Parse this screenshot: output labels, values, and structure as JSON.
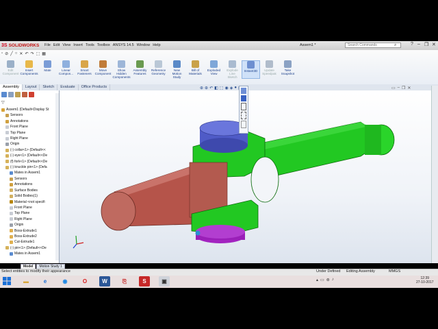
{
  "app": {
    "brand": "SOLIDWORKS",
    "menus": [
      "File",
      "Edit",
      "View",
      "Insert",
      "Tools",
      "Toolbox",
      "ANSYS 14.5",
      "Window",
      "Help"
    ],
    "document_title": "Assem1 *",
    "search_placeholder": "Search Commands"
  },
  "command_manager": [
    {
      "label": "Edit\nComponent",
      "icon": "edit-component-icon",
      "color": "#9bb0c8",
      "disabled": true
    },
    {
      "label": "Insert\nComponents",
      "icon": "insert-components-icon",
      "color": "#e8b84a"
    },
    {
      "label": "Mate",
      "icon": "mate-icon",
      "color": "#7a9cd6"
    },
    {
      "label": "Linear\nCompon...",
      "icon": "linear-pattern-icon",
      "color": "#8fb0de"
    },
    {
      "label": "Smart\nFasteners",
      "icon": "smart-fasteners-icon",
      "color": "#d9a64a"
    },
    {
      "label": "Move\nComponent",
      "icon": "move-component-icon",
      "color": "#c07c3a"
    },
    {
      "label": "Show\nHidden\nComponents",
      "icon": "show-hidden-icon",
      "color": "#9db6d8"
    },
    {
      "label": "Assembly\nFeatures",
      "icon": "assembly-features-icon",
      "color": "#6a9a50"
    },
    {
      "label": "Reference\nGeometry",
      "icon": "reference-geometry-icon",
      "color": "#b9c7d6"
    },
    {
      "label": "New\nMotion\nStudy",
      "icon": "motion-study-icon",
      "color": "#5b8ac8"
    },
    {
      "label": "Bill of\nMaterials",
      "icon": "bill-of-materials-icon",
      "color": "#c9a24a"
    },
    {
      "label": "Exploded\nView",
      "icon": "exploded-view-icon",
      "color": "#7fa7d8"
    },
    {
      "label": "Explode\nLine\nSketch",
      "icon": "explode-line-icon",
      "color": "#aabbd0",
      "disabled": true
    },
    {
      "label": "Instant3D",
      "icon": "instant3d-icon",
      "color": "#6d8fd0",
      "active": true
    },
    {
      "label": "Update\nSpeedpak",
      "icon": "speedpak-icon",
      "color": "#b0bccb",
      "disabled": true
    },
    {
      "label": "Take\nSnapshot",
      "icon": "snapshot-icon",
      "color": "#8ba2c4"
    }
  ],
  "tabs": [
    "Assembly",
    "Layout",
    "Sketch",
    "Evaluate",
    "Office Products"
  ],
  "selected_tab": "Assembly",
  "feature_tree": [
    {
      "label": "Assem1  (Default<Display St",
      "icon": "assembly-icon",
      "color": "#d6a23a",
      "indent": 0
    },
    {
      "label": "Sensors",
      "icon": "sensors-icon",
      "color": "#c8a050",
      "indent": 1
    },
    {
      "label": "Annotations",
      "icon": "annotations-icon",
      "color": "#d0a040",
      "indent": 1
    },
    {
      "label": "Front Plane",
      "icon": "plane-icon",
      "color": "#c8ccd4",
      "indent": 1
    },
    {
      "label": "Top Plane",
      "icon": "plane-icon",
      "color": "#c8ccd4",
      "indent": 1
    },
    {
      "label": "Right Plane",
      "icon": "plane-icon",
      "color": "#c8ccd4",
      "indent": 1
    },
    {
      "label": "Origin",
      "icon": "origin-icon",
      "color": "#9aa0aa",
      "indent": 1
    },
    {
      "label": "(-) collar<1> (Default<<",
      "icon": "part-icon",
      "color": "#d6b25a",
      "indent": 1
    },
    {
      "label": "(-) eye<1> (Default<<De",
      "icon": "part-icon",
      "color": "#d6b25a",
      "indent": 1
    },
    {
      "label": "(f) fork<1> (Default<<De",
      "icon": "part-icon",
      "color": "#d6b25a",
      "indent": 1
    },
    {
      "label": "(-) knuckle pin<1> (Defa",
      "icon": "part-icon",
      "color": "#d6b25a",
      "indent": 1
    },
    {
      "label": "Mates in Assem1",
      "icon": "mates-icon",
      "color": "#5a8bd0",
      "indent": 2
    },
    {
      "label": "Sensors",
      "icon": "sensors-icon",
      "color": "#c8a050",
      "indent": 2
    },
    {
      "label": "Annotations",
      "icon": "annotations-icon",
      "color": "#d0a040",
      "indent": 2
    },
    {
      "label": "Surface Bodies",
      "icon": "surface-bodies-icon",
      "color": "#d2b060",
      "indent": 2
    },
    {
      "label": "Solid Bodies(1)",
      "icon": "solid-bodies-icon",
      "color": "#d2b060",
      "indent": 2
    },
    {
      "label": "Material <not specifi",
      "icon": "material-icon",
      "color": "#b8860b",
      "indent": 2
    },
    {
      "label": "Front Plane",
      "icon": "plane-icon",
      "color": "#c8ccd4",
      "indent": 2
    },
    {
      "label": "Top Plane",
      "icon": "plane-icon",
      "color": "#c8ccd4",
      "indent": 2
    },
    {
      "label": "Right Plane",
      "icon": "plane-icon",
      "color": "#c8ccd4",
      "indent": 2
    },
    {
      "label": "Origin",
      "icon": "origin-icon",
      "color": "#9aa0aa",
      "indent": 2
    },
    {
      "label": "Boss-Extrude1",
      "icon": "extrude-icon",
      "color": "#e0b050",
      "indent": 2
    },
    {
      "label": "Boss-Extrude2",
      "icon": "extrude-icon",
      "color": "#e0b050",
      "indent": 2
    },
    {
      "label": "Cut-Extrude1",
      "icon": "cut-extrude-icon",
      "color": "#e0b050",
      "indent": 2
    },
    {
      "label": "(-) pin<1> (Default<<De",
      "icon": "part-icon",
      "color": "#d6b25a",
      "indent": 1
    },
    {
      "label": "Mates in Assem1",
      "icon": "mates-icon",
      "color": "#5a8bd0",
      "indent": 2
    }
  ],
  "bottom_tabs": [
    "Model",
    "Motion Study 1"
  ],
  "status": {
    "left": "Select entities to modify their appearance",
    "definition": "Under Defined",
    "mode": "Editing Assembly",
    "units": "MMGS"
  },
  "clock": {
    "time": "12:39",
    "date": "27-10-2017"
  },
  "model_colors": {
    "fork": "#22c822",
    "eye": "#b5544a",
    "pin": "#4f5bc7",
    "collar": "#a324c0"
  }
}
